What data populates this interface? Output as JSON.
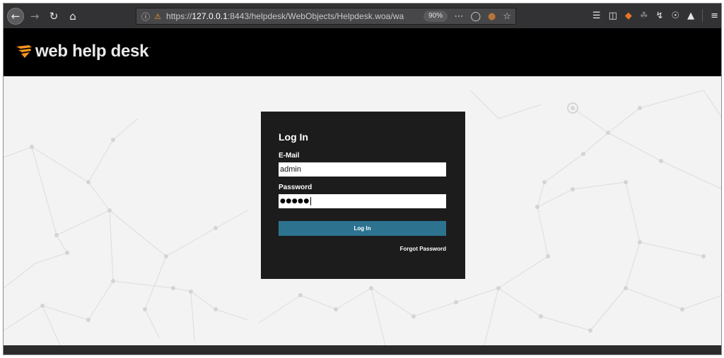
{
  "browser": {
    "url_prefix": "https://",
    "url_host": "127.0.0.1",
    "url_rest": ":8443/helpdesk/WebObjects/Helpdesk.woa/wa",
    "zoom": "90%"
  },
  "app": {
    "logo_text": "web help desk",
    "logo_tm": "·",
    "brand_color": "#f7941d"
  },
  "login": {
    "title": "Log In",
    "email_label": "E-Mail",
    "email_value": "admin",
    "password_label": "Password",
    "password_mask": "●●●●●",
    "submit_label": "Log In",
    "forgot_label": "Forgot Password",
    "button_color": "#2d7390"
  }
}
